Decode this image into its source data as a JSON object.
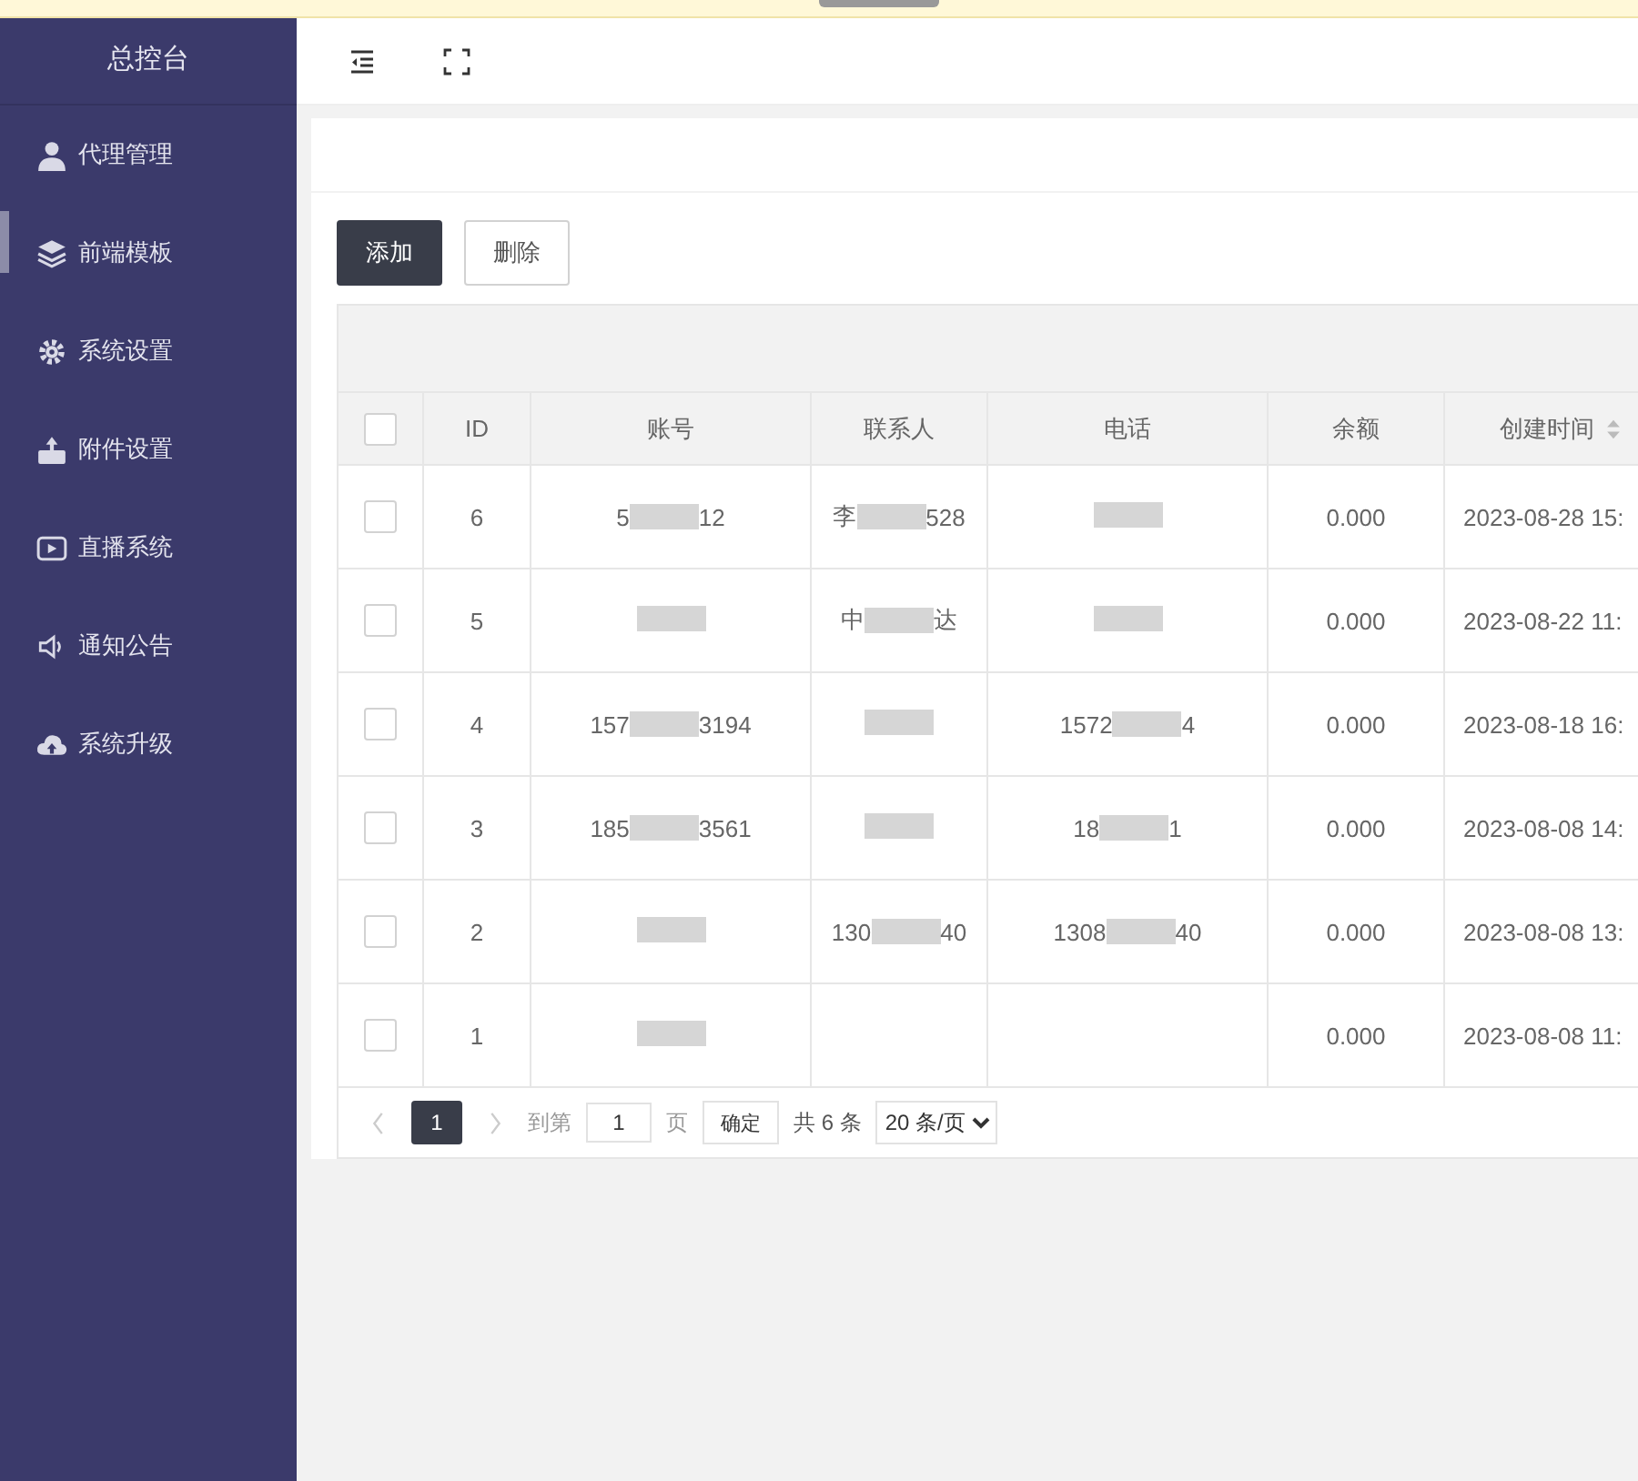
{
  "sidebar": {
    "title": "总控台",
    "items": [
      {
        "label": "代理管理",
        "selected": false
      },
      {
        "label": "前端模板",
        "selected": true
      },
      {
        "label": "系统设置",
        "selected": false
      },
      {
        "label": "附件设置",
        "selected": false
      },
      {
        "label": "直播系统",
        "selected": false
      },
      {
        "label": "通知公告",
        "selected": false
      },
      {
        "label": "系统升级",
        "selected": false
      }
    ]
  },
  "toolbar": {
    "buttons": [
      {
        "label": "添加",
        "kind": "primary"
      },
      {
        "label": "删除",
        "kind": "plain"
      }
    ]
  },
  "table": {
    "all_checked": false,
    "columns": [
      {
        "label": "ID"
      },
      {
        "label": "账号"
      },
      {
        "label": "联系人"
      },
      {
        "label": "电话"
      },
      {
        "label": "余额"
      },
      {
        "label": "创建时间",
        "sortable": true
      }
    ],
    "rows": [
      {
        "checked": false,
        "id": "6",
        "account": {
          "before": "5",
          "after": "12",
          "redacted": true
        },
        "contact": {
          "before": "李",
          "after": "528",
          "redacted": true
        },
        "phone": {
          "redacted": true
        },
        "balance": "0.000",
        "created": "2023-08-28 15:"
      },
      {
        "checked": false,
        "id": "5",
        "account": {
          "redacted": true
        },
        "contact": {
          "before": "中",
          "after": "达",
          "redacted": true
        },
        "phone": {
          "redacted": true
        },
        "balance": "0.000",
        "created": "2023-08-22 11:"
      },
      {
        "checked": false,
        "id": "4",
        "account": {
          "before": "157",
          "after": "3194",
          "redacted": true
        },
        "contact": {
          "redacted": true
        },
        "phone": {
          "before": "1572",
          "after": "4",
          "redacted": true
        },
        "balance": "0.000",
        "created": "2023-08-18 16:"
      },
      {
        "checked": false,
        "id": "3",
        "account": {
          "before": "185",
          "after": "3561",
          "redacted": true
        },
        "contact": {
          "redacted": true
        },
        "phone": {
          "before": "18",
          "after": "1",
          "redacted": true
        },
        "balance": "0.000",
        "created": "2023-08-08 14:"
      },
      {
        "checked": false,
        "id": "2",
        "account": {
          "redacted": true
        },
        "contact": {
          "before": "130",
          "after": "40",
          "redacted": true
        },
        "phone": {
          "before": "1308",
          "after": "40",
          "redacted": true
        },
        "balance": "0.000",
        "created": "2023-08-08 13:"
      },
      {
        "checked": false,
        "id": "1",
        "account": {
          "redacted": true
        },
        "balance": "0.000",
        "created": "2023-08-08 11:"
      }
    ]
  },
  "pagination": {
    "current": "1",
    "goto_label": "到第",
    "goto_value": "1",
    "page_unit": "页",
    "confirm": "确定",
    "total": "共 6 条",
    "page_size": "20 条/页"
  }
}
